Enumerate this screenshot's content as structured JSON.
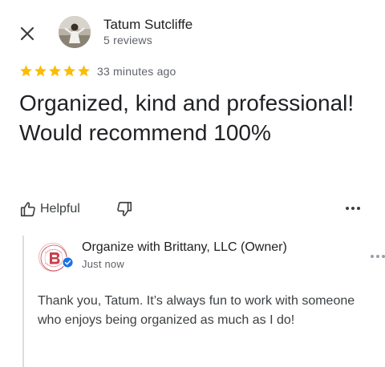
{
  "header": {
    "close_icon": "close-icon",
    "reviewer_name": "Tatum Sutcliffe",
    "review_count": "5 reviews"
  },
  "rating": {
    "stars": 5,
    "max_stars": 5,
    "star_color": "#fbbc04",
    "time_ago": "33 minutes ago"
  },
  "review": {
    "text": "Organized, kind and professional! Would recommend 100%"
  },
  "actions": {
    "helpful_label": "Helpful",
    "helpful_icon": "thumbs-up-icon",
    "unhelpful_icon": "thumbs-down-icon",
    "more_icon": "more-horizontal-icon"
  },
  "owner_reply": {
    "owner_name": "Organize with Brittany, LLC (Owner)",
    "time": "Just now",
    "verified_color": "#1a73e8",
    "brand_color": "#c8414b",
    "logo_text_top": "ORGANIZE",
    "logo_text_bottom": "WITH BRITTANY",
    "text": "Thank you, Tatum. It’s always fun to work with someone who enjoys being organized as much as I do!"
  }
}
